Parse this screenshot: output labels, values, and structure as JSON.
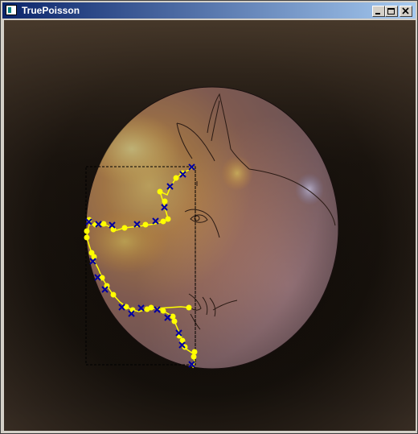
{
  "window": {
    "title": "TruePoisson",
    "icon": "app-window-icon",
    "controls": [
      "minimize-icon",
      "maximize-icon",
      "close-icon"
    ]
  },
  "canvas": {
    "background_colors": [
      "#4a3b2c",
      "#0c0806",
      "#2b261f"
    ],
    "fill_colors": [
      "#f2c15a",
      "#d9975a",
      "#8f6e73",
      "#b7a0b7"
    ],
    "overlay": "selection-rectangle",
    "path_color": "#ffff00",
    "control_point_color": "#0000a0"
  }
}
